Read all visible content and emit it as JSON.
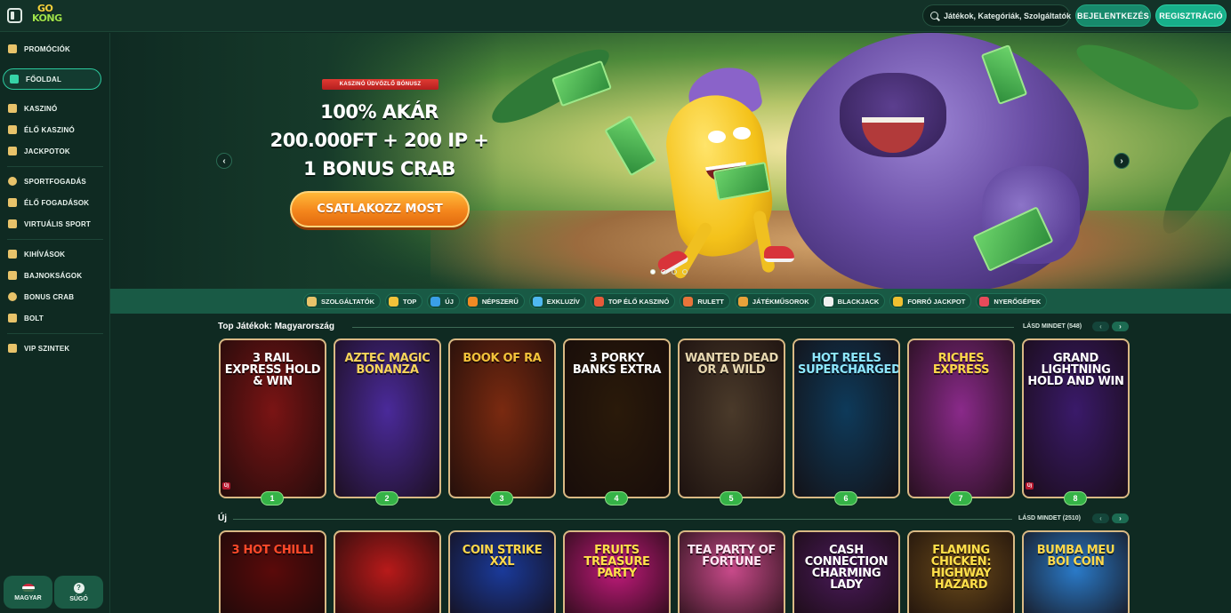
{
  "header": {
    "logo_line1": "GO",
    "logo_line2": "KONG",
    "search_placeholder": "Játékok, Kategóriák, Szolgáltatók",
    "login_label": "BEJELENTKEZÉS",
    "register_label": "REGISZTRÁCIÓ"
  },
  "sidebar": {
    "items": [
      {
        "label": "PROMÓCIÓK",
        "icon": "gift-icon"
      },
      {
        "label": "FŐOLDAL",
        "icon": "home-icon"
      },
      {
        "label": "KASZINÓ",
        "icon": "casino-icon"
      },
      {
        "label": "ÉLŐ KASZINÓ",
        "icon": "live-casino-icon"
      },
      {
        "label": "JACKPOTOK",
        "icon": "clover-icon"
      },
      {
        "label": "SPORTFOGADÁS",
        "icon": "football-icon"
      },
      {
        "label": "ÉLŐ FOGADÁSOK",
        "icon": "live-bets-icon"
      },
      {
        "label": "VIRTUÁLIS SPORT",
        "icon": "virtual-sport-icon"
      },
      {
        "label": "KIHÍVÁSOK",
        "icon": "challenge-icon"
      },
      {
        "label": "BAJNOKSÁGOK",
        "icon": "tournament-icon"
      },
      {
        "label": "BONUS CRAB",
        "icon": "crab-icon"
      },
      {
        "label": "BOLT",
        "icon": "shop-icon"
      },
      {
        "label": "VIP SZINTEK",
        "icon": "diamond-icon"
      }
    ],
    "language_label": "MAGYAR",
    "help_label": "SÚGÓ",
    "help_glyph": "?"
  },
  "hero": {
    "badge": "KASZINÓ ÜDVÖZLŐ BÓNUSZ",
    "title_line1": "100% AKÁR",
    "title_line2": "200.000FT + 200 IP +",
    "title_line3": "1 BONUS CRAB",
    "cta": "CSATLAKOZZ MOST",
    "slides_total": 4,
    "active_slide": 1,
    "prev_glyph": "‹",
    "next_glyph": "›"
  },
  "categories": [
    {
      "label": "SZOLGÁLTATÓK",
      "color": "#e8c36a"
    },
    {
      "label": "TOP",
      "color": "#f2c23a"
    },
    {
      "label": "ÚJ",
      "color": "#3a9fe8"
    },
    {
      "label": "NÉPSZERŰ",
      "color": "#f08a24"
    },
    {
      "label": "EXKLUZÍV",
      "color": "#4fb8f0"
    },
    {
      "label": "TOP ÉLŐ KASZINÓ",
      "color": "#e85a3a"
    },
    {
      "label": "RULETT",
      "color": "#e8743a"
    },
    {
      "label": "JÁTÉKMŰSOROK",
      "color": "#e8a23a"
    },
    {
      "label": "BLACKJACK",
      "color": "#f0f0f0"
    },
    {
      "label": "FORRÓ JACKPOT",
      "color": "#f0c030"
    },
    {
      "label": "NYERŐGÉPEK",
      "color": "#e84a5a"
    }
  ],
  "top_games": {
    "title": "Top Játékok: Magyarország",
    "see_all": "LÁSD MINDET (548)",
    "prev_glyph": "‹",
    "next_glyph": "›",
    "games": [
      {
        "title": "3 RAIL EXPRESS HOLD & WIN",
        "rank": "1",
        "tag": "Új",
        "bg": "#7a1414",
        "fg": "#ffffff"
      },
      {
        "title": "AZTEC MAGIC BONANZA",
        "rank": "2",
        "tag": "",
        "bg": "#4a2a9a",
        "fg": "#f7d45a"
      },
      {
        "title": "BOOK OF RA",
        "rank": "3",
        "tag": "",
        "bg": "#7a2a10",
        "fg": "#f3c23a"
      },
      {
        "title": "3 PORKY BANKS EXTRA",
        "rank": "4",
        "tag": "",
        "bg": "#2a1a0a",
        "fg": "#ffffff"
      },
      {
        "title": "WANTED DEAD OR A WILD",
        "rank": "5",
        "tag": "",
        "bg": "#4a3a2a",
        "fg": "#e8d8b0"
      },
      {
        "title": "HOT REELS SUPERCHARGED",
        "rank": "6",
        "tag": "",
        "bg": "#0e3a5a",
        "fg": "#8ee8ff"
      },
      {
        "title": "RICHES EXPRESS",
        "rank": "7",
        "tag": "",
        "bg": "#8a2a8a",
        "fg": "#ffd84a"
      },
      {
        "title": "GRAND LIGHTNING HOLD AND WIN",
        "rank": "8",
        "tag": "Új",
        "bg": "#3a1a6a",
        "fg": "#ffffff"
      }
    ]
  },
  "new_games": {
    "title": "Új",
    "see_all": "LÁSD MINDET (2510)",
    "prev_glyph": "‹",
    "next_glyph": "›",
    "games": [
      {
        "title": "3 HOT CHILLI",
        "bg": "#5a0a0a",
        "fg": "#ff4a2a"
      },
      {
        "title": "",
        "bg": "#b81a1a",
        "fg": "#ffd84a"
      },
      {
        "title": "COIN STRIKE XXL",
        "bg": "#1a3a9a",
        "fg": "#ffd84a"
      },
      {
        "title": "FRUITS TREASURE PARTY",
        "bg": "#c01a7a",
        "fg": "#ffe04a"
      },
      {
        "title": "TEA PARTY OF FORTUNE",
        "bg": "#c84a8a",
        "fg": "#ffe8f4"
      },
      {
        "title": "CASH CONNECTION CHARMING LADY",
        "bg": "#4a1a5a",
        "fg": "#ffffff"
      },
      {
        "title": "FLAMING CHICKEN: HIGHWAY HAZARD",
        "bg": "#6a4a1a",
        "fg": "#ffe04a"
      },
      {
        "title": "BUMBA MEU BOI COIN",
        "bg": "#2a7ac8",
        "fg": "#ffd84a"
      }
    ]
  }
}
